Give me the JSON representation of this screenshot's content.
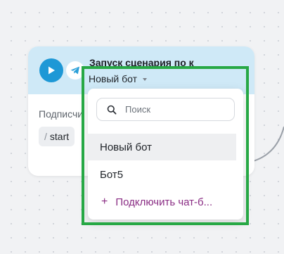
{
  "card": {
    "title": "Запуск сценария по к",
    "bot_selector_value": "Новый бот",
    "subscriptions_label": "Подписчи",
    "trigger_command": "start",
    "trigger_prefix": "/"
  },
  "dropdown": {
    "search_placeholder": "Поиск",
    "items": [
      {
        "label": "Новый бот",
        "selected": true
      },
      {
        "label": "Бот5",
        "selected": false
      }
    ],
    "connect_label": "Подключить чат-б...",
    "connect_prefix": "+"
  },
  "colors": {
    "header_bg": "#cfe9f7",
    "play_button": "#1e98d6",
    "highlight_frame": "#27a845",
    "connect_accent": "#8a2d84"
  },
  "icons": [
    "play-icon",
    "telegram-icon",
    "chevron-down-icon",
    "search-icon",
    "plus-icon"
  ]
}
